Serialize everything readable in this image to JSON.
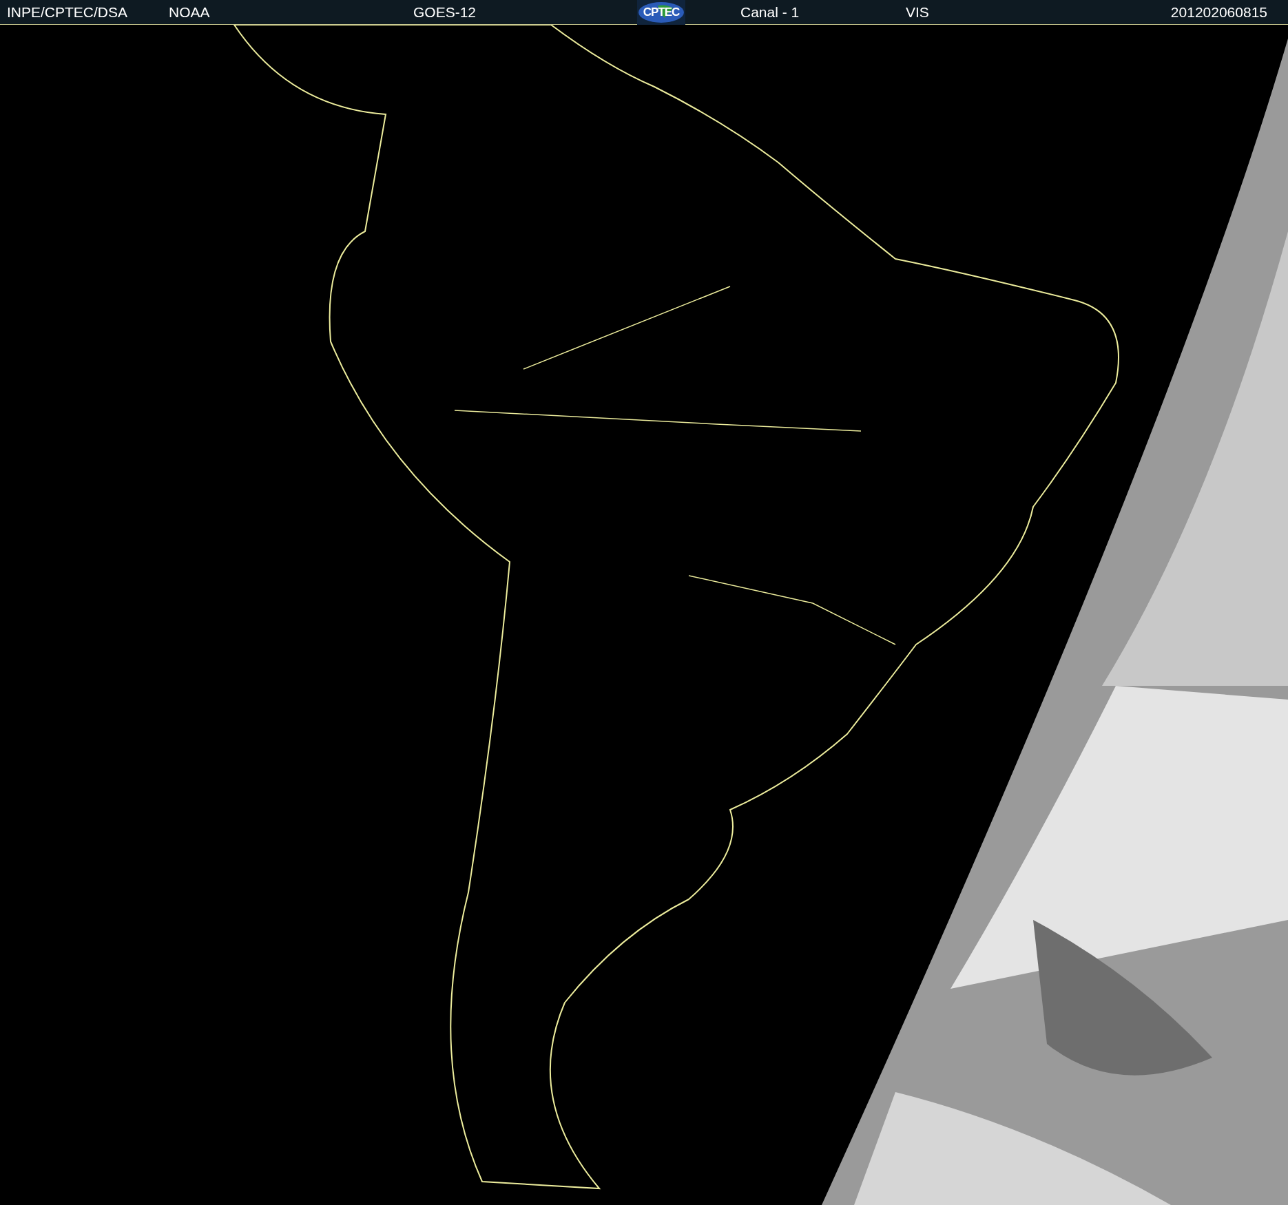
{
  "header": {
    "items": [
      {
        "kind": "text",
        "text": "INPE/CPTEC/DSA"
      },
      {
        "kind": "text",
        "text": "NOAA"
      },
      {
        "kind": "text",
        "text": "GOES-12"
      },
      {
        "kind": "logo",
        "text": "CPTEC"
      },
      {
        "kind": "text",
        "text": "Canal - 1"
      },
      {
        "kind": "text",
        "text": "VIS"
      },
      {
        "kind": "text",
        "text": "201202060815"
      }
    ]
  }
}
